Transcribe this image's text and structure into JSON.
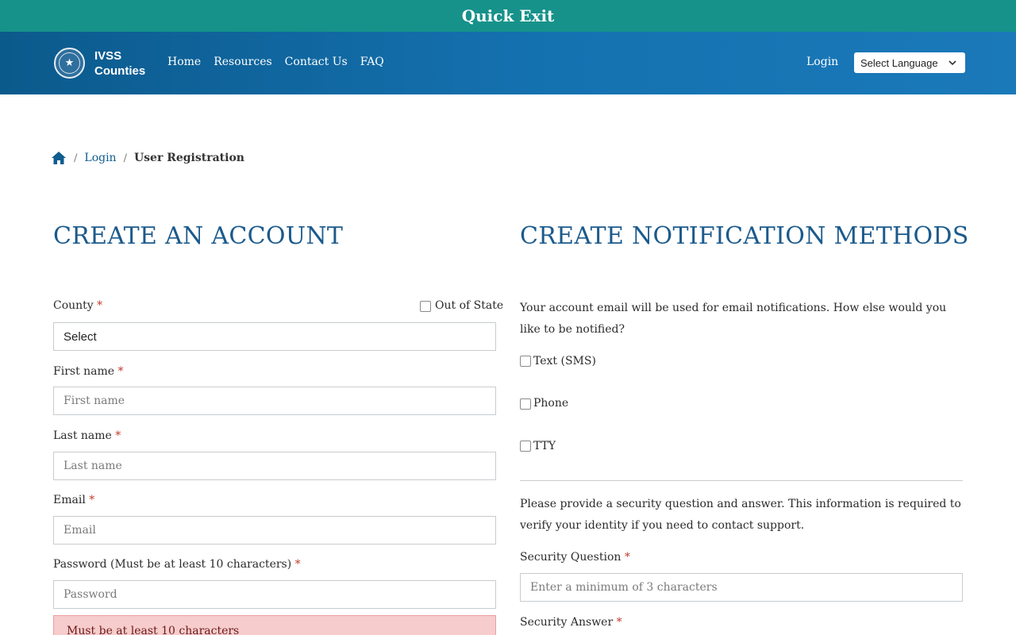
{
  "quick_exit": {
    "label": "Quick Exit"
  },
  "nav": {
    "brand_line1": "IVSS",
    "brand_line2": "Counties",
    "links": [
      "Home",
      "Resources",
      "Contact Us",
      "FAQ"
    ],
    "login_label": "Login",
    "language_select": "Select Language"
  },
  "breadcrumb": {
    "home_icon": "home-icon",
    "login": "Login",
    "current": "User Registration",
    "separator": "/"
  },
  "left": {
    "heading": "CREATE AN ACCOUNT",
    "county_label": "County",
    "required_mark": "*",
    "out_of_state_label": "Out of State",
    "county_value": "Select",
    "first_name_label": "First name",
    "first_name_placeholder": "First name",
    "last_name_label": "Last name",
    "last_name_placeholder": "Last name",
    "email_label": "Email",
    "email_placeholder": "Email",
    "password_label": "Password (Must be at least 10 characters)",
    "password_placeholder": "Password",
    "error_message": "Must be at least 10 characters"
  },
  "right": {
    "heading": "CREATE NOTIFICATION METHODS",
    "intro": "Your account email will be used for email notifications. How else would you like to be notified?",
    "options": [
      "Text (SMS)",
      "Phone",
      "TTY"
    ],
    "security_intro": "Please provide a security question and answer. This information is required to verify your identity if you need to contact support.",
    "security_question_label": "Security Question",
    "security_question_placeholder": "Enter a minimum of 3 characters",
    "security_answer_label": "Security Answer"
  },
  "colors": {
    "quick_exit_bg": "#16928a",
    "nav_bg": "#1572b1",
    "heading": "#1b5a8c",
    "link": "#0f5c8f",
    "required": "#c0392b",
    "error_bg": "#f6cccc"
  }
}
